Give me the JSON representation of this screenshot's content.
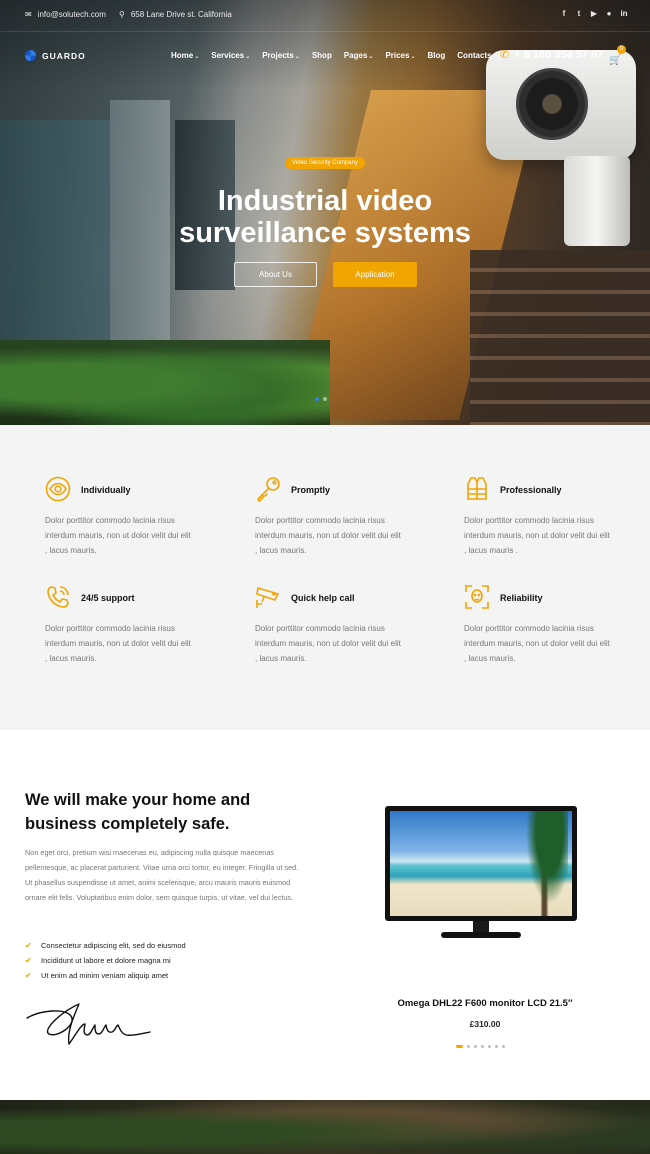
{
  "topbar": {
    "email": "info@solutech.com",
    "address": "658 Lane Drive st. California",
    "social": [
      "facebook-icon",
      "twitter-icon",
      "youtube-icon",
      "github-icon",
      "linkedin-icon"
    ]
  },
  "nav": {
    "logo_text": "GUARDO",
    "items": [
      {
        "label": "Home",
        "dropdown": true
      },
      {
        "label": "Services",
        "dropdown": true
      },
      {
        "label": "Projects",
        "dropdown": true
      },
      {
        "label": "Shop",
        "dropdown": false
      },
      {
        "label": "Pages",
        "dropdown": true
      },
      {
        "label": "Prices",
        "dropdown": true
      },
      {
        "label": "Blog",
        "dropdown": false
      },
      {
        "label": "Contacts",
        "dropdown": false
      }
    ],
    "phone": "+ 8 100 354 57 87",
    "cart_count": "0"
  },
  "hero": {
    "tag": "Video Security Company",
    "title_line1": "Industrial video",
    "title_line2": "surveillance systems",
    "btn_about": "About Us",
    "btn_application": "Application",
    "slides": 2,
    "active_slide": 0
  },
  "features": [
    {
      "title": "Individually",
      "icon": "eye-icon",
      "text": "Dolor porttitor commodo lacinia risus interdum mauris, non ut dolor velit dui elit , lacus mauris."
    },
    {
      "title": "Promptly",
      "icon": "key-icon",
      "text": "Dolor porttitor commodo lacinia risus interdum mauris, non ut dolor velit dui elit , lacus mauris."
    },
    {
      "title": "Professionally",
      "icon": "vest-icon",
      "text": "Dolor porttitor commodo lacinia risus interdum mauris, non ut dolor velit dui elit , lacus mauris ."
    },
    {
      "title": "24/5 support",
      "icon": "phone-icon",
      "text": "Dolor porttitor commodo lacinia risus interdum mauris, non ut dolor velit dui elit , lacus mauris."
    },
    {
      "title": "Quick help call",
      "icon": "cctv-camera-icon",
      "text": "Dolor porttitor commodo lacinia risus interdum mauris, non ut dolor velit dui elit , lacus mauris."
    },
    {
      "title": "Reliability",
      "icon": "face-scan-icon",
      "text": "Dolor porttitor commodo lacinia risus interdum mauris, non ut dolor velit dui elit , lacus mauris."
    }
  ],
  "about": {
    "title_line1": "We will make your home and",
    "title_line2": "business completely safe.",
    "text": "Non eget orci, pretium wisi maecenas eu, adipiscing nulla quisque maecenas pellentesque, ac placerat parturient. Vitae urna orci tortor, eu integer. Fringilla ut sed. Ut phasellus suspendisse ut amet, animi scelerisque, arcu mauris mauris euismod ornare elit felis. Voluptatibus enim dolor, sem quisque turpis, ut vitae, vel dui lectus.",
    "checks": [
      "Consectetur adipiscing elit, sed do eiusmod",
      "Incididunt ut labore et dolore magna mi",
      "Ut enim ad minim veniam aliquip amet"
    ]
  },
  "product": {
    "name": "Omega DHL22 F600 monitor LCD 21.5″",
    "price": "£310.00",
    "slides": 7,
    "active_slide": 0
  },
  "colors": {
    "accent": "#f0a500",
    "brand_blue": "#2f80ed",
    "features_bg": "#f4f4f4",
    "heading": "#111111",
    "body_text": "#777777"
  }
}
